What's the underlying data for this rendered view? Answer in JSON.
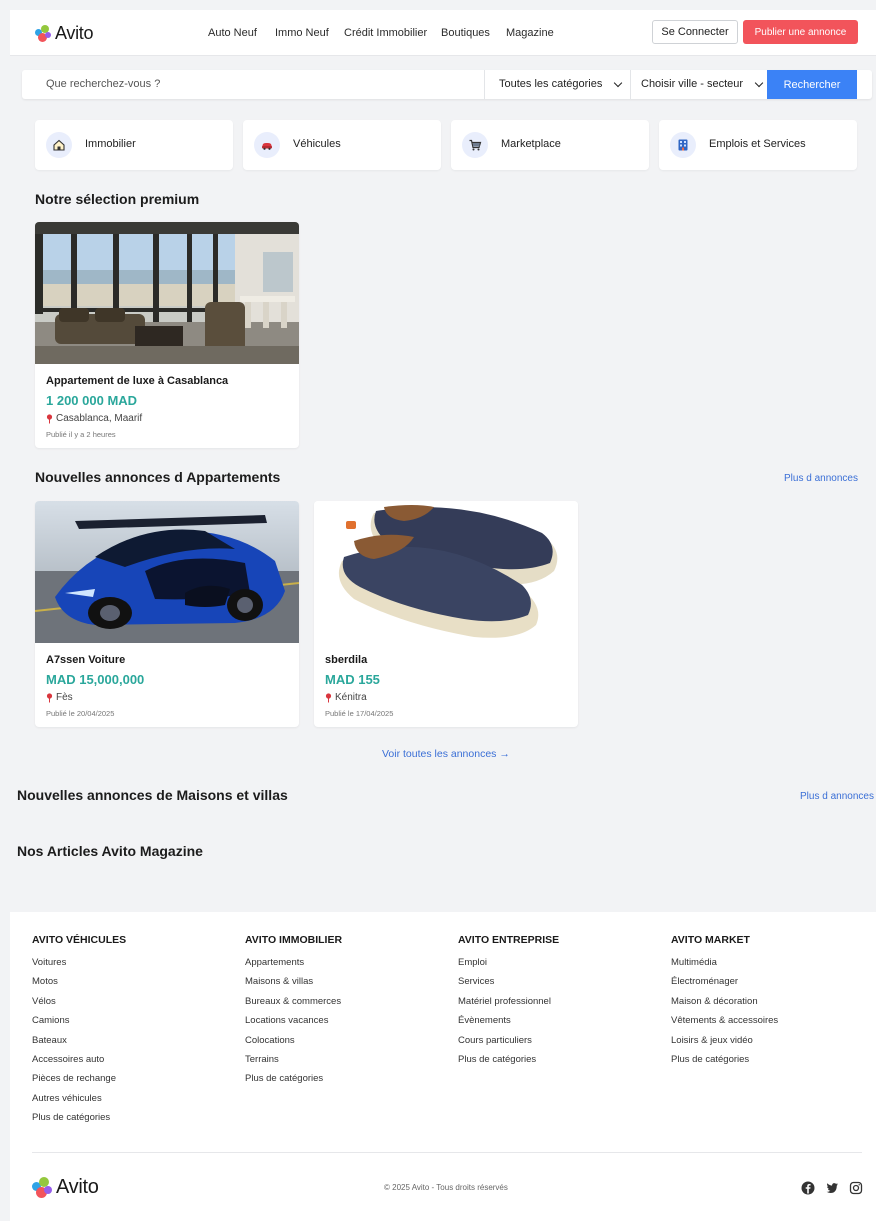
{
  "header": {
    "logo_text": "Avito",
    "nav": [
      "Auto Neuf",
      "Immo Neuf",
      "Crédit Immobilier",
      "Boutiques",
      "Magazine"
    ],
    "connect_label": "Se Connecter",
    "publish_label": "Publier une annonce"
  },
  "search": {
    "placeholder": "Que recherchez-vous ?",
    "category_value": "Toutes les catégories",
    "city_value": "Choisir ville - secteur",
    "button_label": "Rechercher"
  },
  "categories": [
    {
      "label": "Immobilier",
      "icon": "house-icon"
    },
    {
      "label": "Véhicules",
      "icon": "car-icon"
    },
    {
      "label": "Marketplace",
      "icon": "cart-icon"
    },
    {
      "label": "Emplois et Services",
      "icon": "briefcase-icon"
    }
  ],
  "premium": {
    "title": "Notre sélection premium",
    "cards": [
      {
        "title": "Appartement de luxe à Casablanca",
        "price": "1 200 000 MAD",
        "location": "Casablanca, Maarif",
        "date": "Publié il y a 2 heures"
      }
    ]
  },
  "apartments": {
    "title": "Nouvelles annonces d Appartements",
    "more": "Plus d annonces",
    "cards": [
      {
        "title": "A7ssen Voiture",
        "price": "MAD 15,000,000",
        "location": "Fès",
        "date": "Publié le 20/04/2025"
      },
      {
        "title": "sberdila",
        "price": "MAD 155",
        "location": "Kénitra",
        "date": "Publié le 17/04/2025"
      }
    ],
    "see_all": "Voir toutes les annonces →"
  },
  "houses": {
    "title": "Nouvelles annonces de Maisons et villas",
    "more": "Plus d annonces"
  },
  "magazine": {
    "title": "Nos Articles Avito Magazine"
  },
  "footer": {
    "columns": [
      {
        "title": "AVITO VÉHICULES",
        "items": [
          "Voitures",
          "Motos",
          "Vélos",
          "Camions",
          "Bateaux",
          "Accessoires auto",
          "Pièces de rechange",
          "Autres véhicules",
          "Plus de catégories"
        ]
      },
      {
        "title": "AVITO IMMOBILIER",
        "items": [
          "Appartements",
          "Maisons & villas",
          "Bureaux & commerces",
          "Locations vacances",
          "Colocations",
          "Terrains",
          "Plus de catégories"
        ]
      },
      {
        "title": "AVITO ENTREPRISE",
        "items": [
          "Emploi",
          "Services",
          "Matériel professionnel",
          "Évènements",
          "Cours particuliers",
          "Plus de catégories"
        ]
      },
      {
        "title": "AVITO MARKET",
        "items": [
          "Multimédia",
          "Électroménager",
          "Maison & décoration",
          "Vêtements & accessoires",
          "Loisirs & jeux vidéo",
          "Plus de catégories"
        ]
      }
    ],
    "logo_text": "Avito",
    "copyright": "© 2025 Avito - Tous droits réservés",
    "social": [
      "facebook-icon",
      "twitter-icon",
      "instagram-icon"
    ]
  },
  "colors": {
    "brand_red": "#f2545b",
    "search_blue": "#3b82f6",
    "price_teal": "#2aa79b",
    "link_blue": "#3b6fd6"
  }
}
